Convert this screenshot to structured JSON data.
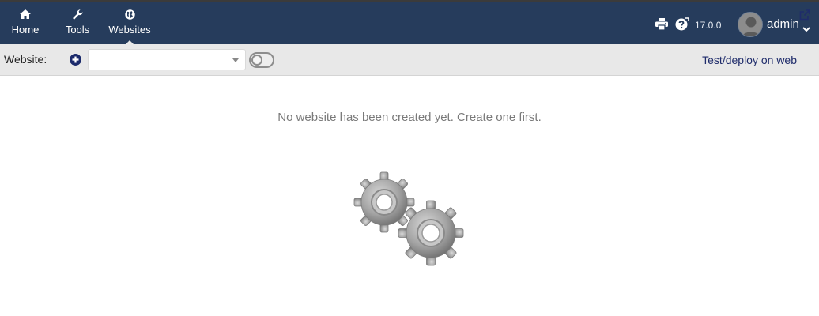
{
  "nav": {
    "items": [
      {
        "label": "Home",
        "icon": "home-icon"
      },
      {
        "label": "Tools",
        "icon": "wrench-icon"
      },
      {
        "label": "Websites",
        "icon": "globe-icon"
      }
    ],
    "version": "17.0.0",
    "user": "admin"
  },
  "toolbar": {
    "website_label": "Website:",
    "website_select_value": "",
    "deploy_label": "Test/deploy on web"
  },
  "main": {
    "empty_message": "No website has been created yet. Create one first."
  },
  "colors": {
    "topbar": "#263c5c",
    "subbar": "#e8e8e8",
    "link": "#1f2c6b"
  }
}
